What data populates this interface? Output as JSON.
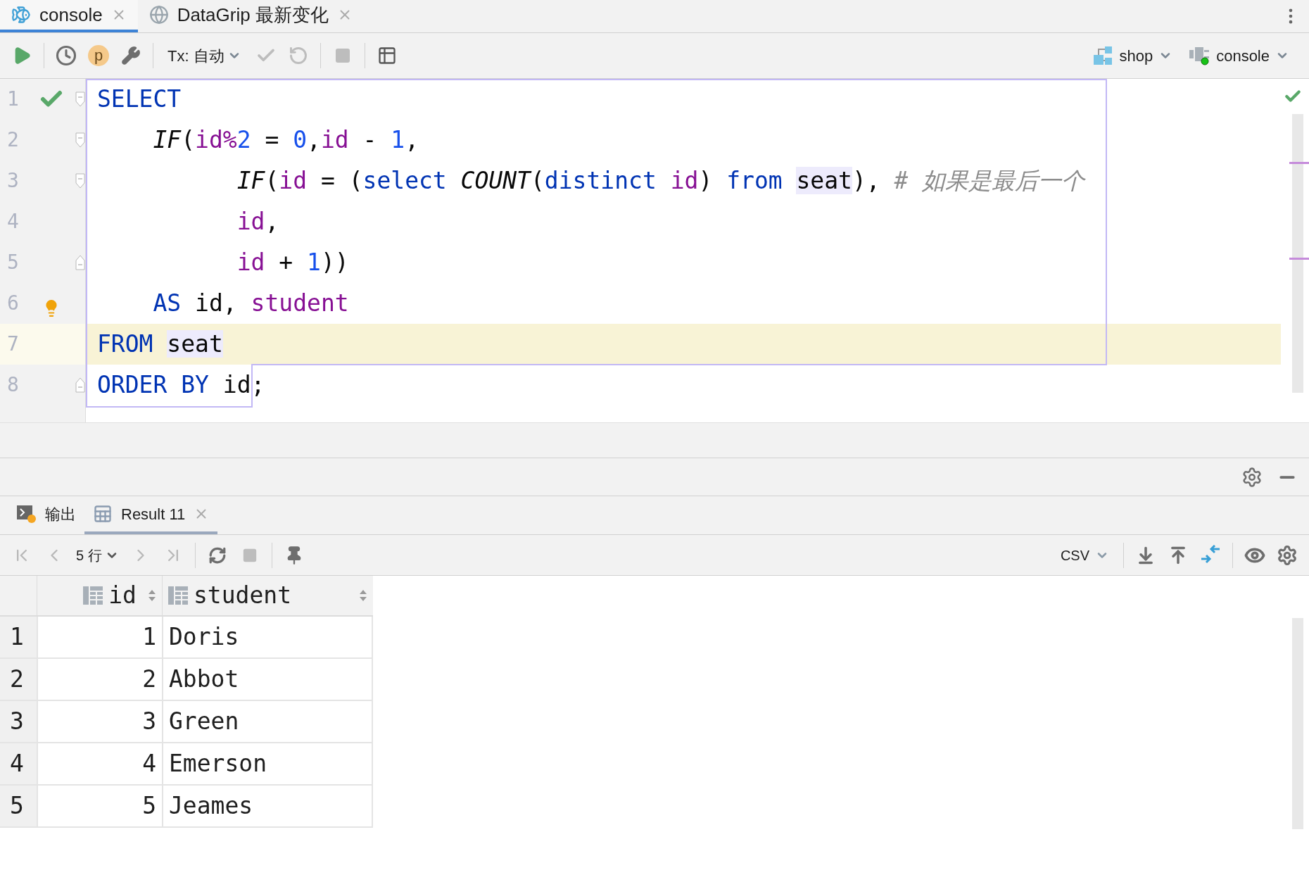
{
  "tabs": [
    {
      "label": "console",
      "selected": true
    },
    {
      "label": "DataGrip 最新变化",
      "selected": false
    }
  ],
  "toolbar": {
    "profile": "p",
    "tx": "Tx: 自动",
    "actions": [
      {
        "kind": "commit",
        "disabled": true
      },
      {
        "kind": "rollback",
        "disabled": true
      },
      {
        "kind": "stop",
        "disabled": true
      }
    ],
    "schema": "shop",
    "session": "console"
  },
  "editor": {
    "lines": [
      {
        "number": "1",
        "executed": true,
        "hint": false,
        "fold_start": true,
        "fold_end": false,
        "current": false,
        "tokens": [
          {
            "kind": "keyword",
            "text": "SELECT"
          }
        ]
      },
      {
        "number": "2",
        "executed": false,
        "hint": false,
        "fold_start": true,
        "fold_end": false,
        "current": false,
        "tokens": [
          {
            "kind": "function",
            "text": "    IF"
          },
          {
            "kind": "plain",
            "text": "("
          },
          {
            "kind": "ident",
            "text": "id"
          },
          {
            "kind": "ident",
            "text": "%"
          },
          {
            "kind": "number",
            "text": "2"
          },
          {
            "kind": "plain",
            "text": " = "
          },
          {
            "kind": "number",
            "text": "0"
          },
          {
            "kind": "plain",
            "text": ","
          },
          {
            "kind": "ident",
            "text": "id"
          },
          {
            "kind": "plain",
            "text": " - "
          },
          {
            "kind": "number",
            "text": "1"
          },
          {
            "kind": "plain",
            "text": ","
          }
        ]
      },
      {
        "number": "3",
        "executed": false,
        "hint": false,
        "fold_start": true,
        "fold_end": false,
        "current": false,
        "tokens": [
          {
            "kind": "function",
            "text": "          IF"
          },
          {
            "kind": "plain",
            "text": "("
          },
          {
            "kind": "ident",
            "text": "id"
          },
          {
            "kind": "plain",
            "text": " = ("
          },
          {
            "kind": "keyword",
            "text": "select "
          },
          {
            "kind": "function",
            "text": "COUNT"
          },
          {
            "kind": "plain",
            "text": "("
          },
          {
            "kind": "keyword",
            "text": "distinct "
          },
          {
            "kind": "ident",
            "text": "id"
          },
          {
            "kind": "plain",
            "text": ") "
          },
          {
            "kind": "keyword",
            "text": "from "
          },
          {
            "kind": "table",
            "text": "seat"
          },
          {
            "kind": "plain",
            "text": "), "
          },
          {
            "kind": "comment",
            "text": "# 如果是最后一个"
          }
        ]
      },
      {
        "number": "4",
        "executed": false,
        "hint": false,
        "fold_start": false,
        "fold_end": false,
        "current": false,
        "tokens": [
          {
            "kind": "ident",
            "text": "          id"
          },
          {
            "kind": "plain",
            "text": ","
          }
        ]
      },
      {
        "number": "5",
        "executed": false,
        "hint": false,
        "fold_start": false,
        "fold_end": true,
        "current": false,
        "tokens": [
          {
            "kind": "ident",
            "text": "          id"
          },
          {
            "kind": "plain",
            "text": " + "
          },
          {
            "kind": "number",
            "text": "1"
          },
          {
            "kind": "plain",
            "text": "))"
          }
        ]
      },
      {
        "number": "6",
        "executed": false,
        "hint": true,
        "fold_start": false,
        "fold_end": false,
        "current": false,
        "tokens": [
          {
            "kind": "keyword",
            "text": "    AS"
          },
          {
            "kind": "plain",
            "text": " id, "
          },
          {
            "kind": "ident",
            "text": "student"
          }
        ]
      },
      {
        "number": "7",
        "executed": false,
        "hint": false,
        "fold_start": false,
        "fold_end": false,
        "current": true,
        "tokens": [
          {
            "kind": "keyword",
            "text": "FROM "
          },
          {
            "kind": "table",
            "text": "seat"
          }
        ]
      },
      {
        "number": "8",
        "executed": false,
        "hint": false,
        "fold_start": false,
        "fold_end": true,
        "current": false,
        "tokens": [
          {
            "kind": "keyword",
            "text": "ORDER BY"
          },
          {
            "kind": "plain",
            "text": " id;"
          }
        ]
      }
    ]
  },
  "results": {
    "tabs": [
      {
        "label": "输出",
        "selected": false
      },
      {
        "label": "Result 11",
        "selected": true
      }
    ],
    "toolbar": {
      "rows": "5 行",
      "format": "CSV"
    },
    "table": {
      "columns": [
        "id",
        "student"
      ],
      "rows": [
        {
          "number": "1",
          "cells": [
            "1",
            "Doris"
          ]
        },
        {
          "number": "2",
          "cells": [
            "2",
            "Abbot"
          ]
        },
        {
          "number": "3",
          "cells": [
            "3",
            "Green"
          ]
        },
        {
          "number": "4",
          "cells": [
            "4",
            "Emerson"
          ]
        },
        {
          "number": "5",
          "cells": [
            "5",
            "Jeames"
          ]
        }
      ]
    }
  }
}
